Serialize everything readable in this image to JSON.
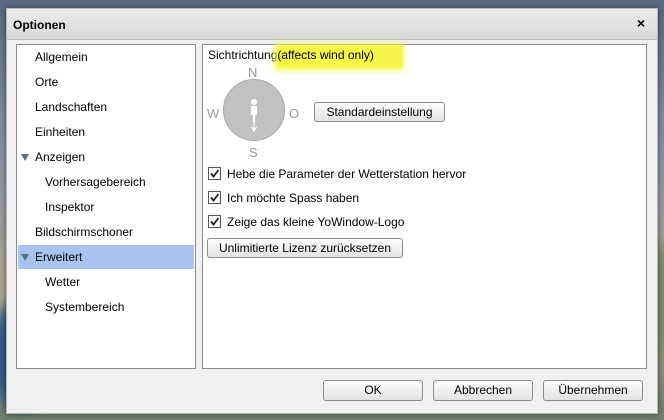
{
  "dialog": {
    "title": "Optionen",
    "close_symbol": "×"
  },
  "sidebar": {
    "items": [
      {
        "label": "Allgemein"
      },
      {
        "label": "Orte"
      },
      {
        "label": "Landschaften"
      },
      {
        "label": "Einheiten"
      },
      {
        "label": "Anzeigen",
        "expanded": true
      },
      {
        "label": "Vorhersagebereich"
      },
      {
        "label": "Inspektor"
      },
      {
        "label": "Bildschirmschoner"
      },
      {
        "label": "Erweitert",
        "expanded": true,
        "selected": true
      },
      {
        "label": "Wetter"
      },
      {
        "label": "Systembereich"
      }
    ]
  },
  "main": {
    "heading_prefix": "Sichtrichtung",
    "heading_highlight": "(affects wind only)",
    "compass": {
      "n": "N",
      "s": "S",
      "w": "W",
      "o": "O"
    },
    "reset_direction_button": "Standardeinstellung",
    "checkboxes": [
      {
        "label": "Hebe die Parameter der Wetterstation hervor",
        "checked": true
      },
      {
        "label": "Ich möchte Spass haben",
        "checked": true
      },
      {
        "label": "Zeige das kleine YoWindow-Logo",
        "checked": true
      }
    ],
    "reset_license_button": "Unlimitierte Lizenz zurücksetzen"
  },
  "footer": {
    "ok": "OK",
    "cancel": "Abbrechen",
    "apply": "Übernehmen"
  },
  "colors": {
    "selection": "#a8c4ee",
    "highlight": "#f6f64a",
    "compass_fill": "#c2c2c2"
  }
}
